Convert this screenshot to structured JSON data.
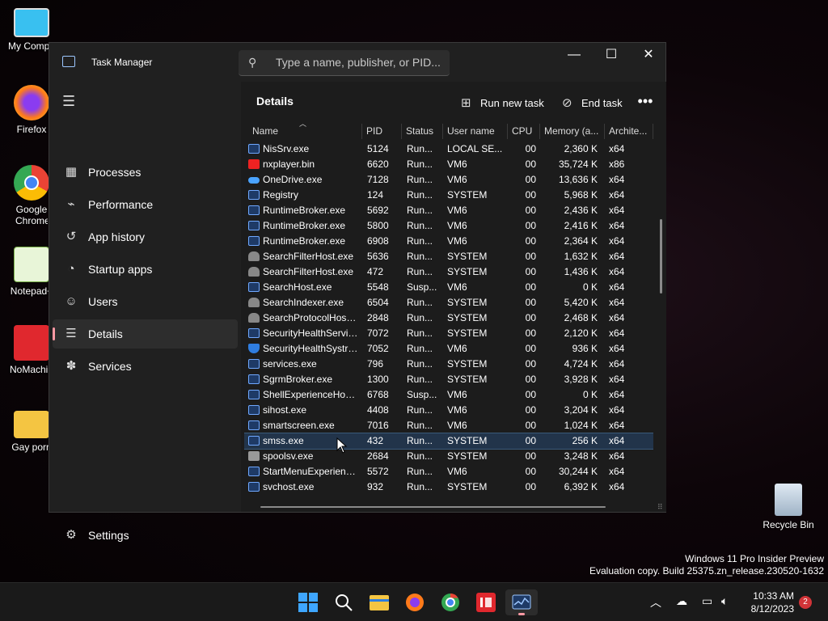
{
  "desktop": {
    "icons": [
      {
        "label": "My Compu"
      },
      {
        "label": "Firefox"
      },
      {
        "label": "Google Chrome"
      },
      {
        "label": "Notepad+"
      },
      {
        "label": "NoMachin"
      },
      {
        "label": "Gay porn"
      },
      {
        "label": "Recycle Bin"
      }
    ],
    "watermark": {
      "line1": "Windows 11 Pro Insider Preview",
      "line2": "Evaluation copy. Build 25375.zn_release.230520-1632"
    }
  },
  "window": {
    "title": "Task Manager",
    "search_placeholder": "Type a name, publisher, or PID...",
    "controls": {
      "minimize": "—",
      "maximize": "☐",
      "close": "✕"
    }
  },
  "sidebar": {
    "items": [
      {
        "label": "Processes",
        "icon": "processes-icon"
      },
      {
        "label": "Performance",
        "icon": "performance-icon"
      },
      {
        "label": "App history",
        "icon": "app-history-icon"
      },
      {
        "label": "Startup apps",
        "icon": "startup-apps-icon"
      },
      {
        "label": "Users",
        "icon": "users-icon"
      },
      {
        "label": "Details",
        "icon": "details-icon",
        "active": true
      },
      {
        "label": "Services",
        "icon": "services-icon"
      }
    ],
    "settings_label": "Settings"
  },
  "main": {
    "title": "Details",
    "run_new_task": "Run new task",
    "end_task": "End task",
    "more": "•••",
    "columns": [
      "Name",
      "PID",
      "Status",
      "User name",
      "CPU",
      "Memory (a...",
      "Archite..."
    ],
    "rows": [
      {
        "icon": "generic",
        "name": "NisSrv.exe",
        "pid": "5124",
        "status": "Run...",
        "user": "LOCAL SE...",
        "cpu": "00",
        "mem": "2,360 K",
        "arch": "x64"
      },
      {
        "icon": "nx",
        "name": "nxplayer.bin",
        "pid": "6620",
        "status": "Run...",
        "user": "VM6",
        "cpu": "00",
        "mem": "35,724 K",
        "arch": "x86"
      },
      {
        "icon": "cloud",
        "name": "OneDrive.exe",
        "pid": "7128",
        "status": "Run...",
        "user": "VM6",
        "cpu": "00",
        "mem": "13,636 K",
        "arch": "x64"
      },
      {
        "icon": "generic",
        "name": "Registry",
        "pid": "124",
        "status": "Run...",
        "user": "SYSTEM",
        "cpu": "00",
        "mem": "5,968 K",
        "arch": "x64"
      },
      {
        "icon": "generic",
        "name": "RuntimeBroker.exe",
        "pid": "5692",
        "status": "Run...",
        "user": "VM6",
        "cpu": "00",
        "mem": "2,436 K",
        "arch": "x64"
      },
      {
        "icon": "generic",
        "name": "RuntimeBroker.exe",
        "pid": "5800",
        "status": "Run...",
        "user": "VM6",
        "cpu": "00",
        "mem": "2,416 K",
        "arch": "x64"
      },
      {
        "icon": "generic",
        "name": "RuntimeBroker.exe",
        "pid": "6908",
        "status": "Run...",
        "user": "VM6",
        "cpu": "00",
        "mem": "2,364 K",
        "arch": "x64"
      },
      {
        "icon": "search",
        "name": "SearchFilterHost.exe",
        "pid": "5636",
        "status": "Run...",
        "user": "SYSTEM",
        "cpu": "00",
        "mem": "1,632 K",
        "arch": "x64"
      },
      {
        "icon": "search",
        "name": "SearchFilterHost.exe",
        "pid": "472",
        "status": "Run...",
        "user": "SYSTEM",
        "cpu": "00",
        "mem": "1,436 K",
        "arch": "x64"
      },
      {
        "icon": "generic",
        "name": "SearchHost.exe",
        "pid": "5548",
        "status": "Susp...",
        "user": "VM6",
        "cpu": "00",
        "mem": "0 K",
        "arch": "x64"
      },
      {
        "icon": "search",
        "name": "SearchIndexer.exe",
        "pid": "6504",
        "status": "Run...",
        "user": "SYSTEM",
        "cpu": "00",
        "mem": "5,420 K",
        "arch": "x64"
      },
      {
        "icon": "search",
        "name": "SearchProtocolHost....",
        "pid": "2848",
        "status": "Run...",
        "user": "SYSTEM",
        "cpu": "00",
        "mem": "2,468 K",
        "arch": "x64"
      },
      {
        "icon": "generic",
        "name": "SecurityHealthServic...",
        "pid": "7072",
        "status": "Run...",
        "user": "SYSTEM",
        "cpu": "00",
        "mem": "2,120 K",
        "arch": "x64"
      },
      {
        "icon": "shield",
        "name": "SecurityHealthSystra...",
        "pid": "7052",
        "status": "Run...",
        "user": "VM6",
        "cpu": "00",
        "mem": "936 K",
        "arch": "x64"
      },
      {
        "icon": "generic",
        "name": "services.exe",
        "pid": "796",
        "status": "Run...",
        "user": "SYSTEM",
        "cpu": "00",
        "mem": "4,724 K",
        "arch": "x64"
      },
      {
        "icon": "generic",
        "name": "SgrmBroker.exe",
        "pid": "1300",
        "status": "Run...",
        "user": "SYSTEM",
        "cpu": "00",
        "mem": "3,928 K",
        "arch": "x64"
      },
      {
        "icon": "generic",
        "name": "ShellExperienceHost....",
        "pid": "6768",
        "status": "Susp...",
        "user": "VM6",
        "cpu": "00",
        "mem": "0 K",
        "arch": "x64"
      },
      {
        "icon": "generic",
        "name": "sihost.exe",
        "pid": "4408",
        "status": "Run...",
        "user": "VM6",
        "cpu": "00",
        "mem": "3,204 K",
        "arch": "x64"
      },
      {
        "icon": "generic",
        "name": "smartscreen.exe",
        "pid": "7016",
        "status": "Run...",
        "user": "VM6",
        "cpu": "00",
        "mem": "1,024 K",
        "arch": "x64"
      },
      {
        "icon": "generic",
        "name": "smss.exe",
        "pid": "432",
        "status": "Run...",
        "user": "SYSTEM",
        "cpu": "00",
        "mem": "256 K",
        "arch": "x64",
        "selected": true
      },
      {
        "icon": "printer",
        "name": "spoolsv.exe",
        "pid": "2684",
        "status": "Run...",
        "user": "SYSTEM",
        "cpu": "00",
        "mem": "3,248 K",
        "arch": "x64"
      },
      {
        "icon": "generic",
        "name": "StartMenuExperienc...",
        "pid": "5572",
        "status": "Run...",
        "user": "VM6",
        "cpu": "00",
        "mem": "30,244 K",
        "arch": "x64"
      },
      {
        "icon": "generic",
        "name": "svchost.exe",
        "pid": "932",
        "status": "Run...",
        "user": "SYSTEM",
        "cpu": "00",
        "mem": "6,392 K",
        "arch": "x64"
      }
    ]
  },
  "taskbar": {
    "apps": [
      "start",
      "search",
      "file-explorer",
      "firefox",
      "chrome",
      "nomachine",
      "task-manager"
    ],
    "clock_time": "10:33 AM",
    "clock_date": "8/12/2023",
    "notification_count": "2"
  }
}
